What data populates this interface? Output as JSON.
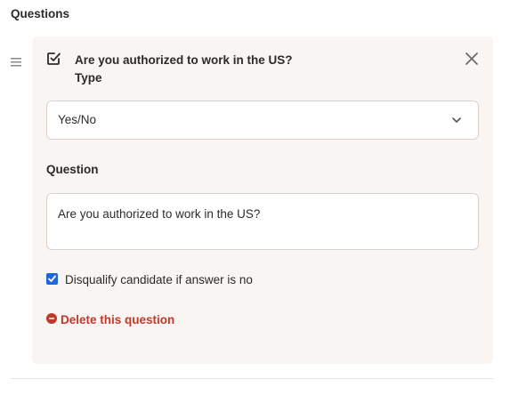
{
  "section": {
    "title": "Questions"
  },
  "question_card": {
    "title": "Are you authorized to work in the US?",
    "type_label": "Type",
    "type_value": "Yes/No",
    "question_label": "Question",
    "question_value": "Are you authorized to work in the US?",
    "disqualify_checked": true,
    "disqualify_label": "Disqualify candidate if answer is no",
    "delete_label": "Delete this question"
  },
  "icons": {
    "drag": "drag-handle-icon",
    "edit": "edit-checkbox-icon",
    "close": "close-icon",
    "chevron": "chevron-down-icon",
    "delete": "minus-circle-icon"
  },
  "colors": {
    "card_background": "#f9f5f2",
    "accent_checkbox": "#1f66d6",
    "danger": "#c0392b",
    "text": "#2b2b2b"
  }
}
